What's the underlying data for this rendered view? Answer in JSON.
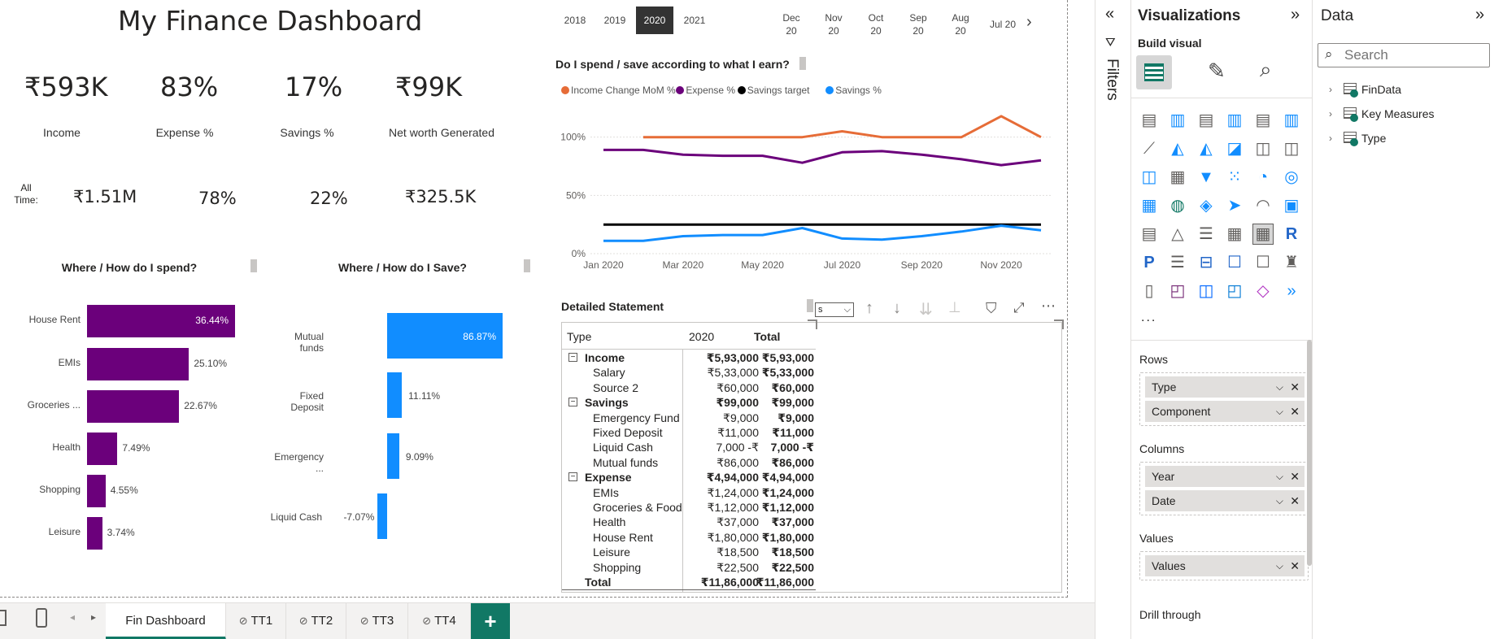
{
  "title": "My Finance Dashboard",
  "kpis": [
    {
      "value": "₹593K",
      "label": "Income"
    },
    {
      "value": "83%",
      "label": "Expense %"
    },
    {
      "value": "17%",
      "label": "Savings %"
    },
    {
      "value": "₹99K",
      "label": "Net worth Generated"
    }
  ],
  "all_time": {
    "label": "All\nTime:",
    "values": [
      "₹1.51M",
      "78%",
      "22%",
      "₹325.5K"
    ]
  },
  "years": [
    "2018",
    "2019",
    "2020",
    "2021"
  ],
  "selected_year": "2020",
  "months": [
    {
      "m": "Dec",
      "y": "20"
    },
    {
      "m": "Nov",
      "y": "20"
    },
    {
      "m": "Oct",
      "y": "20"
    },
    {
      "m": "Sep",
      "y": "20"
    },
    {
      "m": "Aug",
      "y": "20"
    },
    {
      "m": "Jul 20",
      "y": ""
    }
  ],
  "spend_chart": {
    "title": "Where / How do I spend?"
  },
  "save_chart": {
    "title": "Where / How do I Save?"
  },
  "line_chart_meta": {
    "title": "Do I spend / save according to what I earn?"
  },
  "matrix": {
    "title": "Detailed Statement",
    "headers": [
      "Type",
      "2020",
      "Total"
    ],
    "rows": [
      {
        "label": "Income",
        "level": 0,
        "v1": "₹5,93,000",
        "v2": "₹5,93,000"
      },
      {
        "label": "Salary",
        "level": 1,
        "v1": "₹5,33,000",
        "v2": "₹5,33,000"
      },
      {
        "label": "Source 2",
        "level": 1,
        "v1": "₹60,000",
        "v2": "₹60,000"
      },
      {
        "label": "Savings",
        "level": 0,
        "v1": "₹99,000",
        "v2": "₹99,000"
      },
      {
        "label": "Emergency Fund",
        "level": 1,
        "v1": "₹9,000",
        "v2": "₹9,000"
      },
      {
        "label": "Fixed Deposit",
        "level": 1,
        "v1": "₹11,000",
        "v2": "₹11,000"
      },
      {
        "label": "Liquid Cash",
        "level": 1,
        "v1": "7,000 -₹",
        "v2": "7,000 -₹"
      },
      {
        "label": "Mutual funds",
        "level": 1,
        "v1": "₹86,000",
        "v2": "₹86,000"
      },
      {
        "label": "Expense",
        "level": 0,
        "v1": "₹4,94,000",
        "v2": "₹4,94,000"
      },
      {
        "label": "EMIs",
        "level": 1,
        "v1": "₹1,24,000",
        "v2": "₹1,24,000"
      },
      {
        "label": "Groceries & Food",
        "level": 1,
        "v1": "₹1,12,000",
        "v2": "₹1,12,000"
      },
      {
        "label": "Health",
        "level": 1,
        "v1": "₹37,000",
        "v2": "₹37,000"
      },
      {
        "label": "House Rent",
        "level": 1,
        "v1": "₹1,80,000",
        "v2": "₹1,80,000"
      },
      {
        "label": "Leisure",
        "level": 1,
        "v1": "₹18,500",
        "v2": "₹18,500"
      },
      {
        "label": "Shopping",
        "level": 1,
        "v1": "₹22,500",
        "v2": "₹22,500"
      },
      {
        "label": "Total",
        "level": 2,
        "v1": "₹11,86,000",
        "v2": "₹11,86,000"
      }
    ],
    "dropdown_value": "s"
  },
  "filters_label": "Filters",
  "viz_pane": {
    "title": "Visualizations",
    "build_visual": "Build visual",
    "more": "...",
    "wells": [
      {
        "head": "Rows",
        "items": [
          "Type",
          "Component"
        ]
      },
      {
        "head": "Columns",
        "items": [
          "Year",
          "Date"
        ]
      },
      {
        "head": "Values",
        "items": [
          "Values"
        ]
      }
    ],
    "drill_through": "Drill through"
  },
  "data_pane": {
    "title": "Data",
    "search_placeholder": "Search",
    "tables": [
      "FinData",
      "Key Measures",
      "Type"
    ]
  },
  "tabs": [
    "Fin Dashboard",
    "TT1",
    "TT2",
    "TT3",
    "TT4"
  ],
  "colors": {
    "purple": "#6b007b",
    "blue": "#118dff",
    "orange": "#e66c37",
    "black": "#000000",
    "accent": "#117865"
  },
  "chart_data": [
    {
      "type": "bar",
      "orientation": "horizontal",
      "title": "Where / How do I spend?",
      "categories": [
        "House Rent",
        "EMIs",
        "Groceries ...",
        "Health",
        "Shopping",
        "Leisure"
      ],
      "values": [
        36.44,
        25.1,
        22.67,
        7.49,
        4.55,
        3.74
      ],
      "labels": [
        "36.44%",
        "25.10%",
        "22.67%",
        "7.49%",
        "4.55%",
        "3.74%"
      ],
      "color": "#6b007b"
    },
    {
      "type": "bar",
      "orientation": "horizontal",
      "title": "Where / How do I Save?",
      "categories": [
        "Mutual funds",
        "Fixed Deposit",
        "Emergency ...",
        "Liquid Cash"
      ],
      "values": [
        86.87,
        11.11,
        9.09,
        -7.07
      ],
      "labels": [
        "86.87%",
        "11.11%",
        "9.09%",
        "-7.07%"
      ],
      "color": "#118dff"
    },
    {
      "type": "line",
      "title": "Do I spend / save according to what I earn?",
      "x": [
        "Jan 2020",
        "Feb 2020",
        "Mar 2020",
        "Apr 2020",
        "May 2020",
        "Jun 2020",
        "Jul 2020",
        "Aug 2020",
        "Sep 2020",
        "Oct 2020",
        "Nov 2020",
        "Dec 2020"
      ],
      "x_tick_labels": [
        "Jan 2020",
        "Mar 2020",
        "May 2020",
        "Jul 2020",
        "Sep 2020",
        "Nov 2020"
      ],
      "y_tick_labels": [
        "0%",
        "50%",
        "100%"
      ],
      "ylim": [
        0,
        120
      ],
      "legend_position": "top-left",
      "series": [
        {
          "name": "Income Change MoM %",
          "color": "#e66c37",
          "values": [
            null,
            100,
            100,
            100,
            100,
            100,
            105,
            100,
            100,
            100,
            118,
            100
          ]
        },
        {
          "name": "Expense %",
          "color": "#6b007b",
          "values": [
            89,
            89,
            85,
            84,
            84,
            78,
            87,
            88,
            85,
            81,
            76,
            80
          ]
        },
        {
          "name": "Savings target",
          "color": "#000000",
          "values": [
            25,
            25,
            25,
            25,
            25,
            25,
            25,
            25,
            25,
            25,
            25,
            25
          ]
        },
        {
          "name": "Savings %",
          "color": "#118dff",
          "values": [
            11,
            11,
            15,
            16,
            16,
            22,
            13,
            12,
            15,
            19,
            24,
            20
          ]
        }
      ]
    }
  ]
}
